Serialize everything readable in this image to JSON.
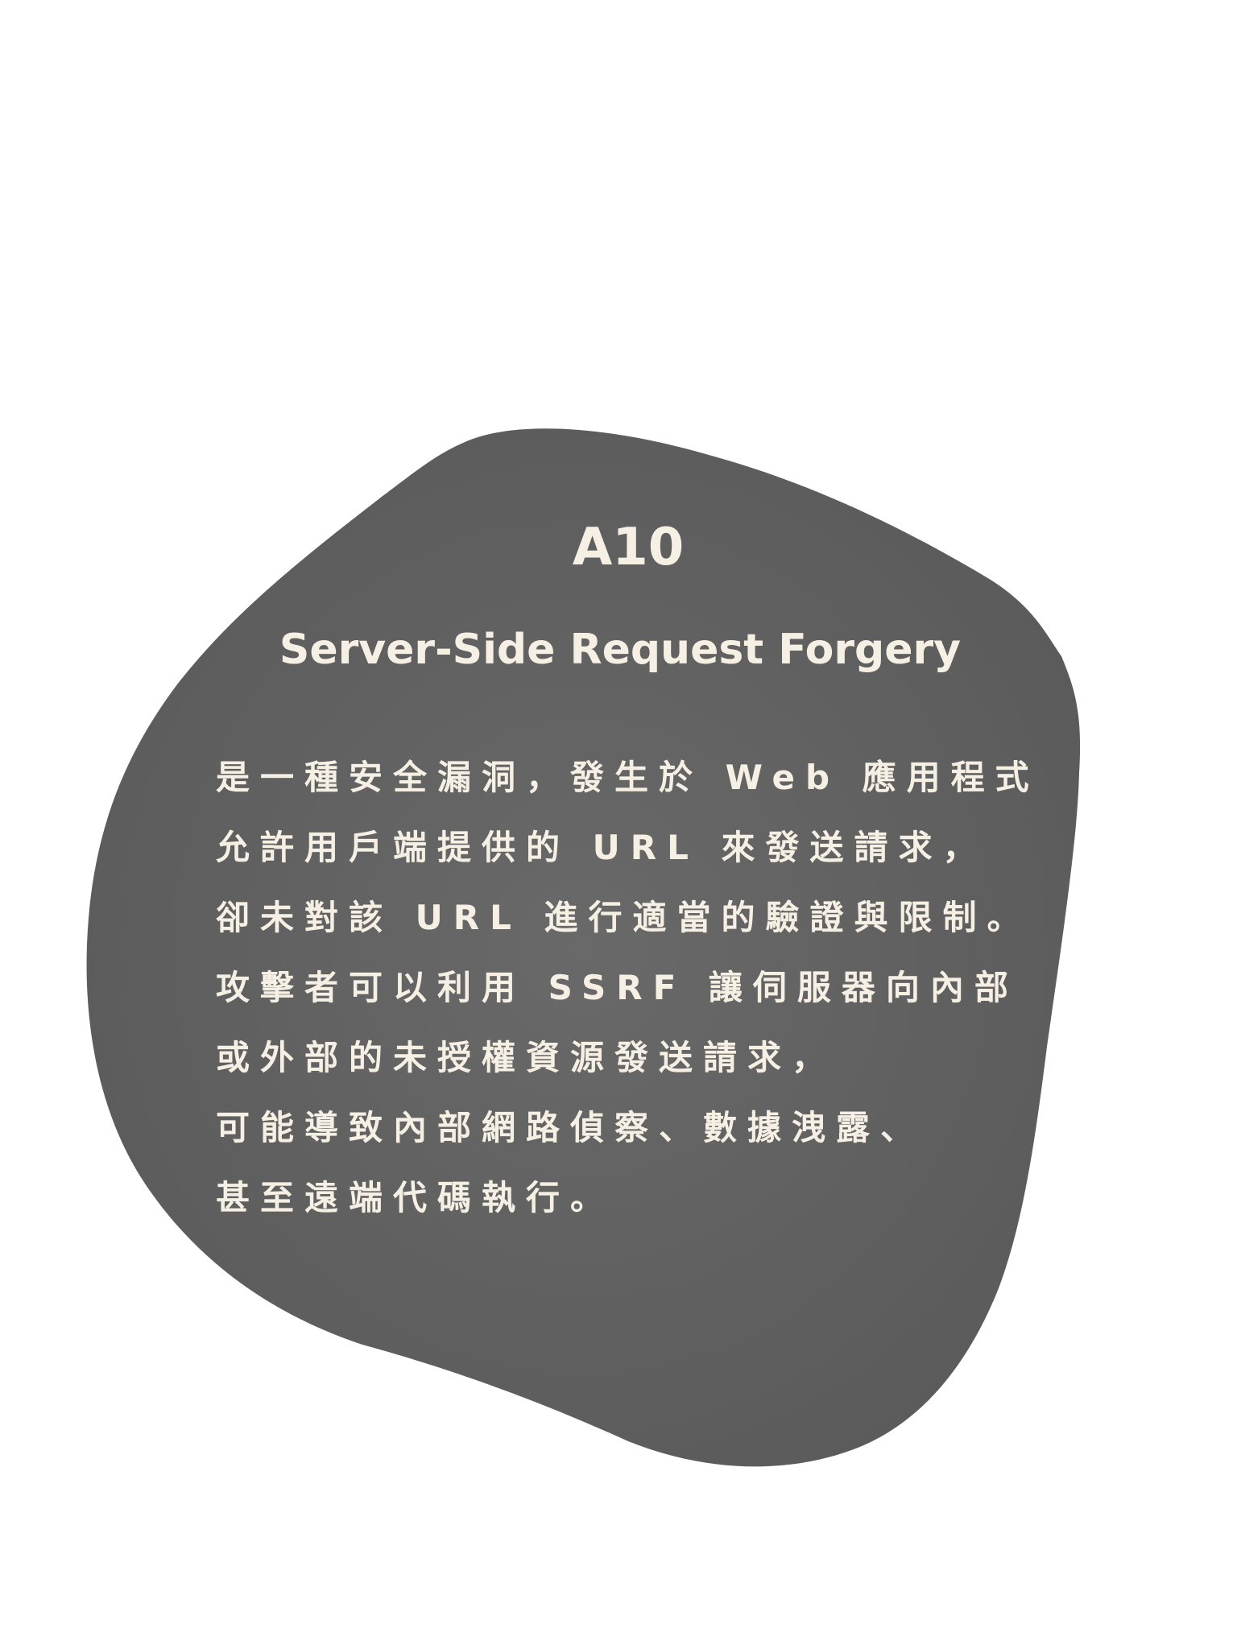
{
  "card": {
    "code": "A10",
    "title": "Server-Side Request Forgery",
    "description_lines": [
      "是一種安全漏洞，發生於 Web 應用程式",
      "允許用戶端提供的 URL 來發送請求，",
      "卻未對該 URL 進行適當的驗證與限制。",
      "攻擊者可以利用 SSRF 讓伺服器向內部",
      "或外部的未授權資源發送請求，",
      "可能導致內部網路偵察、數據洩露、",
      "甚至遠端代碼執行。"
    ]
  },
  "colors": {
    "background": "#ffffff",
    "blob": "#5f5f5f",
    "text": "#f5efe4"
  }
}
